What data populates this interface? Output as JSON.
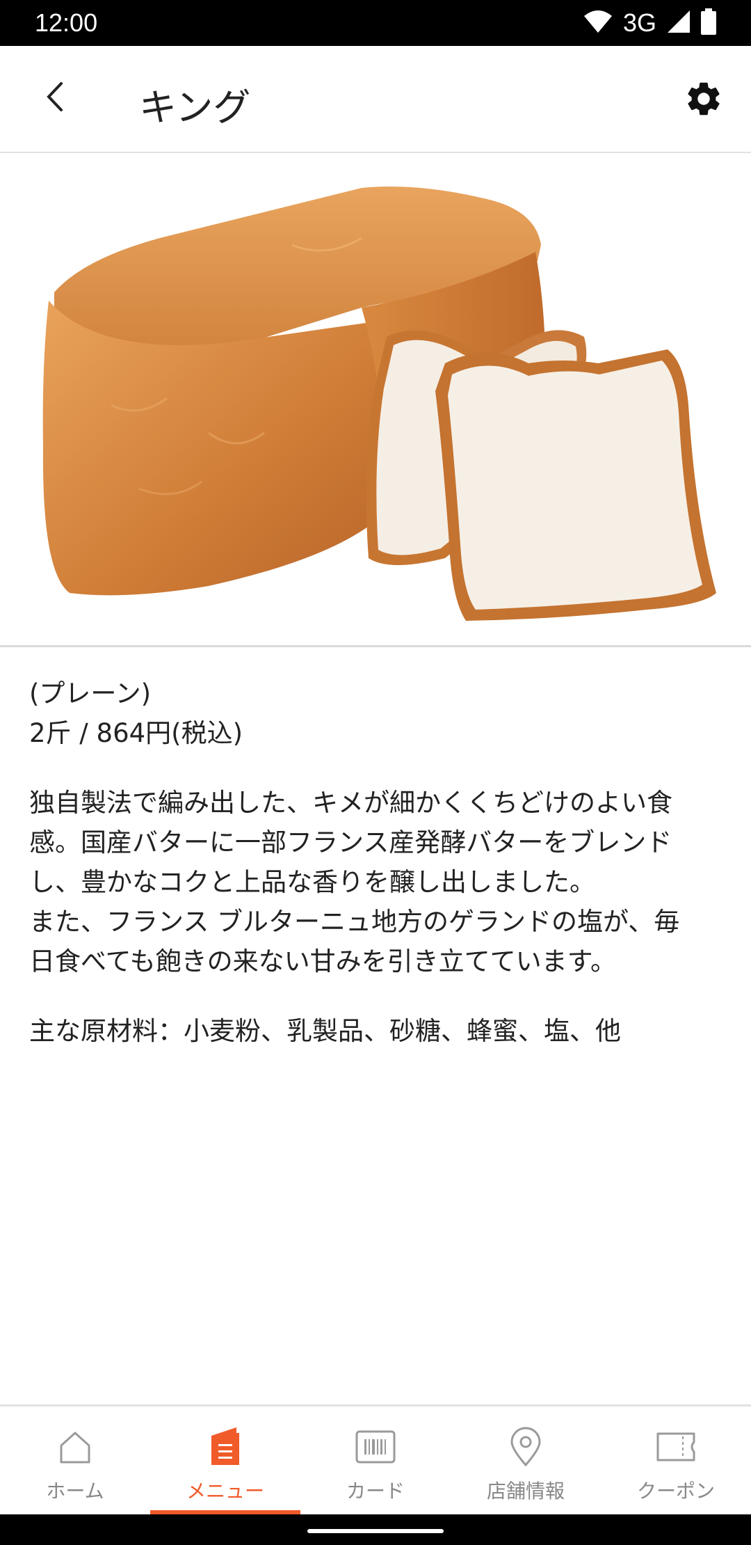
{
  "status_bar": {
    "time": "12:00",
    "network": "3G",
    "icons": [
      "wifi-icon",
      "signal-icon",
      "battery-icon"
    ]
  },
  "app_bar": {
    "title": "キング",
    "back_icon": "chevron-left-icon",
    "settings_icon": "gear-icon"
  },
  "product": {
    "image": "bread-loaf-photo",
    "variant": "(プレーン)",
    "price": "2斤 / 864円(税込)",
    "description": "独自製法で編み出した、キメが細かくくちどけのよい食\n感。国産バターに一部フランス産発酵バターをブレンド\nし、豊かなコクと上品な香りを醸し出しました。\nまた、フランス ブルターニュ地方のゲランドの塩が、毎\n日食べても飽きの来ない甘みを引き立てています。",
    "ingredients": "主な原材料：小麦粉、乳製品、砂糖、蜂蜜、塩、他"
  },
  "bottom_nav": {
    "items": [
      {
        "label": "ホーム",
        "icon": "home-icon",
        "active": false
      },
      {
        "label": "メニュー",
        "icon": "menu-icon",
        "active": true
      },
      {
        "label": "カード",
        "icon": "barcode-card-icon",
        "active": false
      },
      {
        "label": "店舗情報",
        "icon": "location-pin-icon",
        "active": false
      },
      {
        "label": "クーポン",
        "icon": "coupon-ticket-icon",
        "active": false
      }
    ]
  },
  "colors": {
    "accent": "#f15a29",
    "inactive": "#888888",
    "crust": "#d4843f",
    "crumb": "#f6eee4"
  }
}
